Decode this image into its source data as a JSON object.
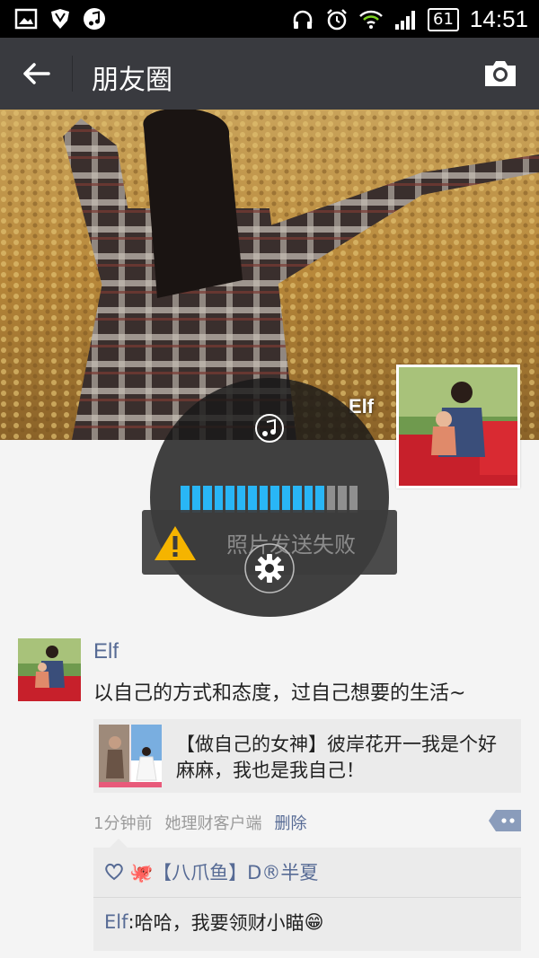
{
  "status_bar": {
    "battery": "61",
    "time": "14:51",
    "left_icons": [
      "gallery-icon",
      "shield-icon",
      "music-note-icon"
    ],
    "right_icons": [
      "headphones-icon",
      "alarm-icon",
      "wifi-icon",
      "signal-icon"
    ]
  },
  "nav": {
    "title": "朋友圈",
    "back_icon": "arrow-left-icon",
    "camera_icon": "camera-icon"
  },
  "cover": {
    "user_name": "Elf"
  },
  "overlay": {
    "progress": {
      "filled": 13,
      "total": 16
    },
    "toast_text": "照片发送失败",
    "accent": "#29b6f6",
    "warning_color": "#f5b400"
  },
  "post": {
    "author": "Elf",
    "text": "以自己的方式和态度，过自己想要的生活~",
    "share": {
      "title": "【做自己的女神】彼岸花开一我是个好麻麻，我也是我自己！"
    },
    "time": "1分钟前",
    "source": "她理财客户端",
    "delete_label": "删除",
    "likes": "🐙【八爪鱼】D®半夏",
    "comment": {
      "author": "Elf",
      "separator": ": ",
      "text": "哈哈，我要领财小瞄",
      "emoji": "😁"
    }
  },
  "colors": {
    "link": "#576b95",
    "navbar": "#393a3f"
  }
}
